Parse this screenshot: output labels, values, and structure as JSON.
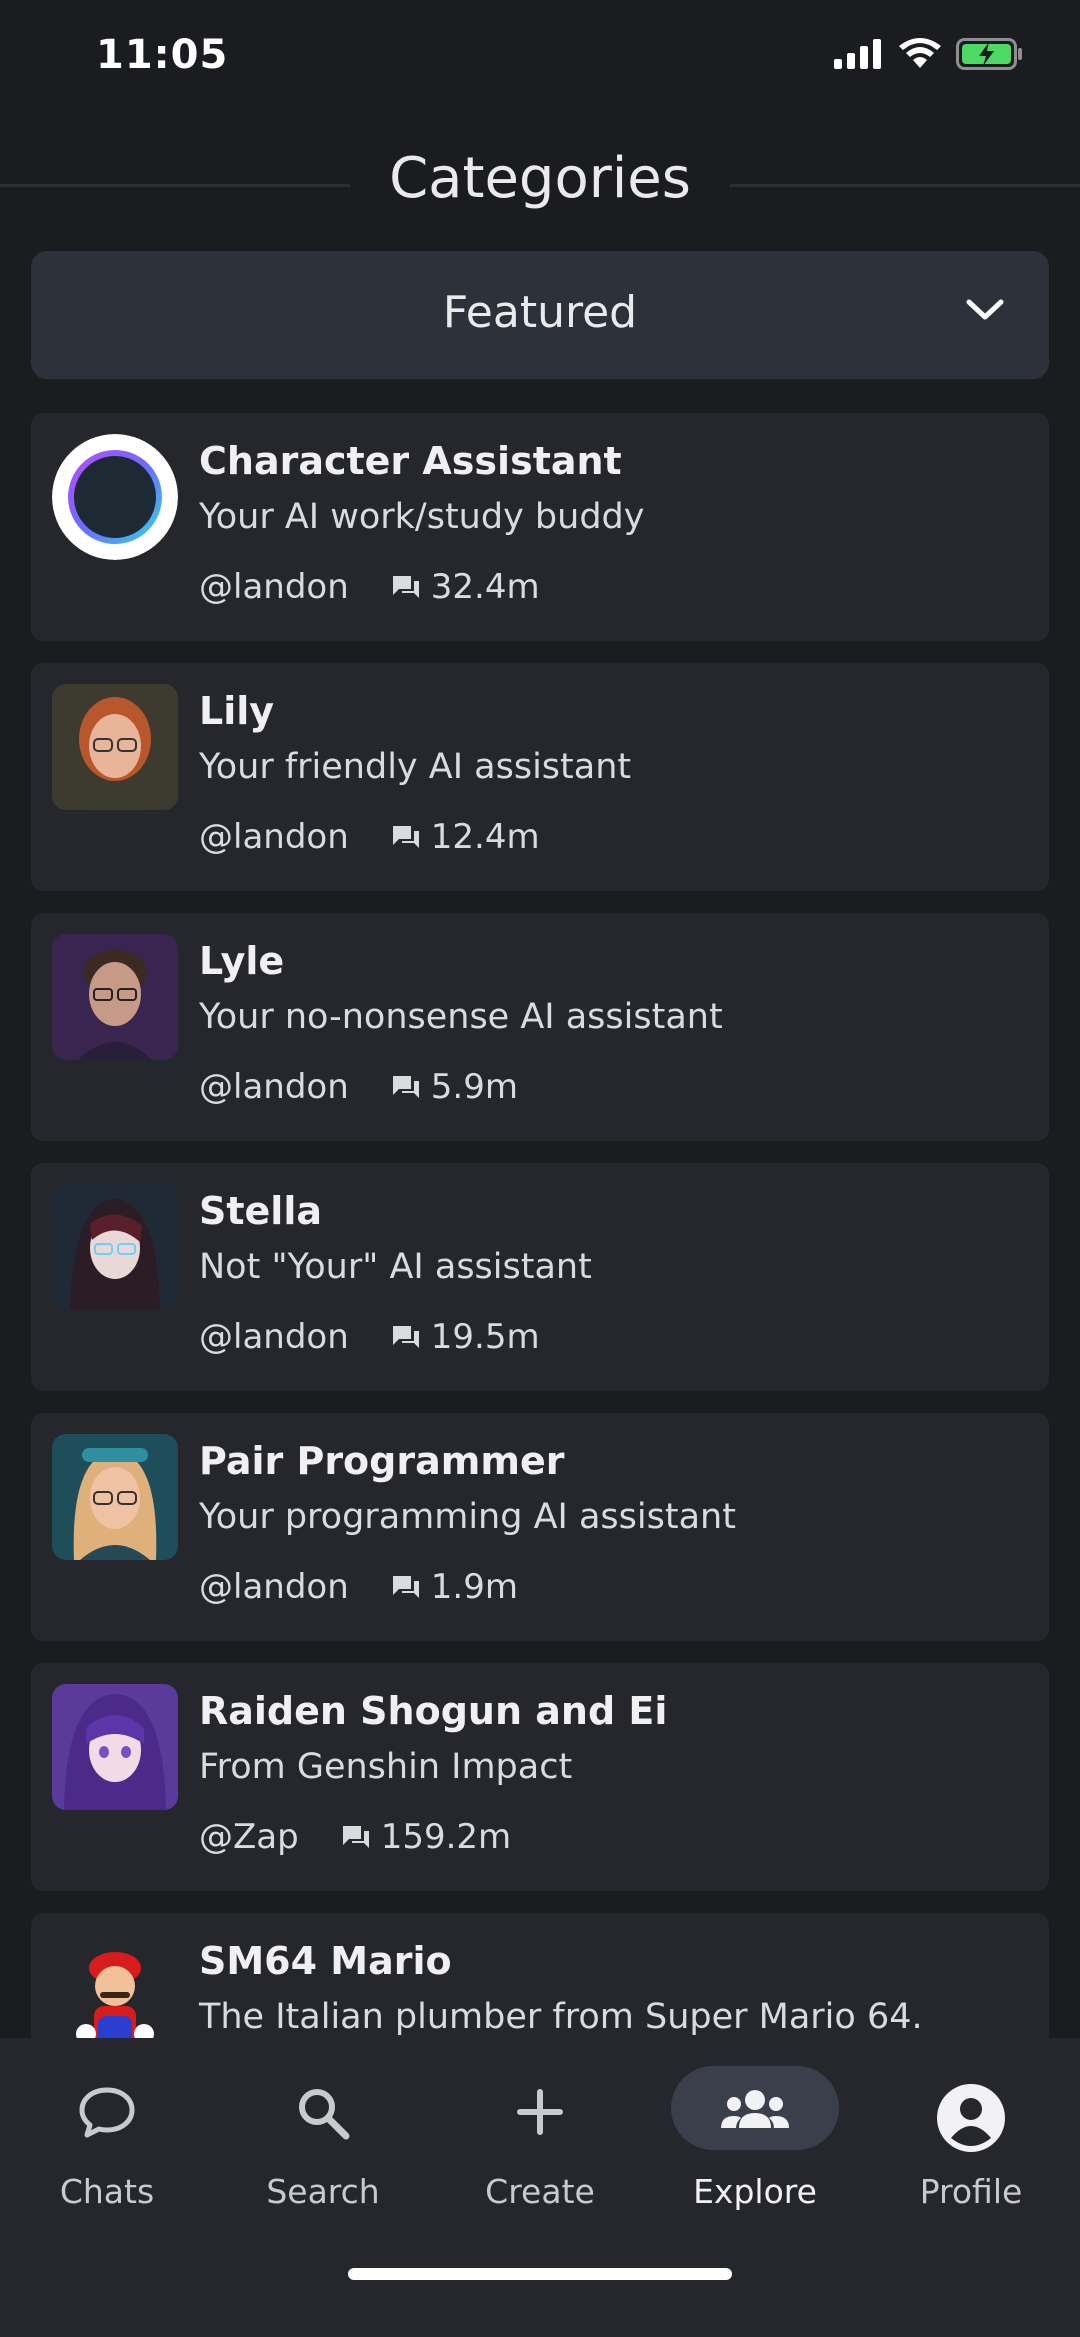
{
  "status": {
    "time": "11:05"
  },
  "categories": {
    "title": "Categories"
  },
  "dropdown": {
    "selected": "Featured"
  },
  "characters": [
    {
      "name": "Character Assistant",
      "description": "Your AI work/study buddy",
      "author": "@landon",
      "chats": "32.4m"
    },
    {
      "name": "Lily",
      "description": "Your friendly AI assistant",
      "author": "@landon",
      "chats": "12.4m"
    },
    {
      "name": "Lyle",
      "description": "Your no-nonsense AI assistant",
      "author": "@landon",
      "chats": "5.9m"
    },
    {
      "name": "Stella",
      "description": "Not \"Your\" AI assistant",
      "author": "@landon",
      "chats": "19.5m"
    },
    {
      "name": "Pair Programmer",
      "description": "Your programming AI assistant",
      "author": "@landon",
      "chats": "1.9m"
    },
    {
      "name": "Raiden Shogun and Ei",
      "description": "From Genshin Impact",
      "author": "@Zap",
      "chats": "159.2m"
    },
    {
      "name": "SM64 Mario",
      "description": "The Italian plumber from Super Mario 64."
    }
  ],
  "nav": {
    "chats": "Chats",
    "search": "Search",
    "create": "Create",
    "explore": "Explore",
    "profile": "Profile",
    "active": "explore"
  },
  "colors": {
    "background": "#1b1c1f",
    "card": "#26272c",
    "dropdown": "#2d3139",
    "active_pill": "#3a3f4b",
    "battery": "#4cd964"
  }
}
